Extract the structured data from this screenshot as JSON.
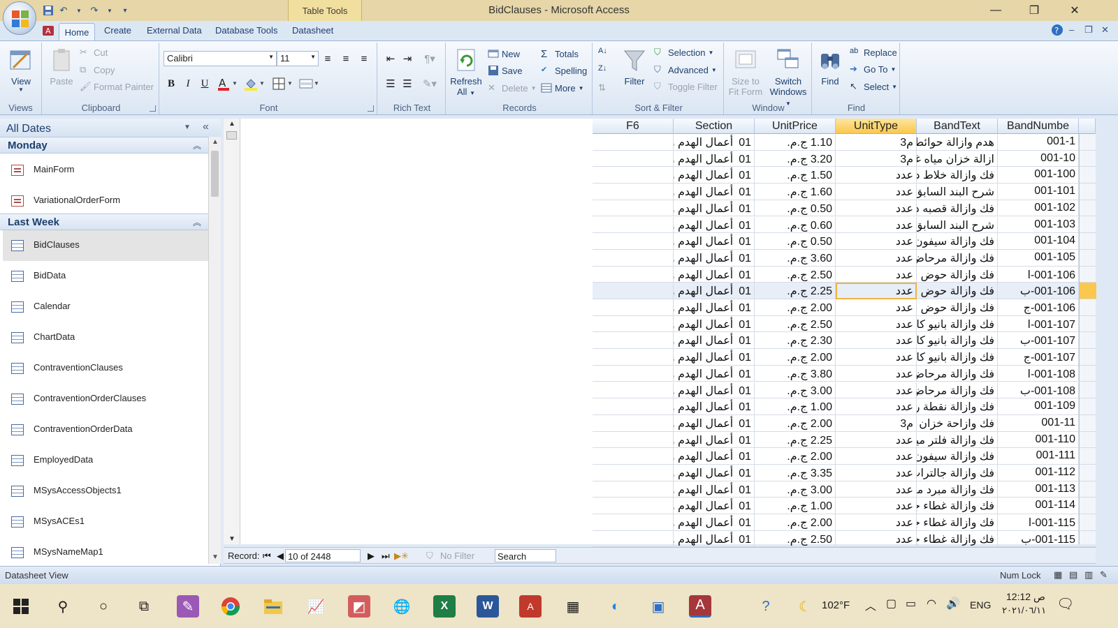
{
  "window": {
    "title": "BidClauses - Microsoft Access",
    "context_tab": "Table Tools"
  },
  "ribbon_tabs": [
    "Home",
    "Create",
    "External Data",
    "Database Tools",
    "Datasheet"
  ],
  "ribbon": {
    "views": {
      "view_label": "View",
      "group": "Views"
    },
    "clipboard": {
      "paste": "Paste",
      "cut": "Cut",
      "copy": "Copy",
      "format_painter": "Format Painter",
      "group": "Clipboard"
    },
    "font": {
      "font_name": "Calibri",
      "font_size": "11",
      "bold": "B",
      "italic": "I",
      "underline": "U",
      "group": "Font"
    },
    "rich_text": {
      "group": "Rich Text"
    },
    "records": {
      "refresh": "Refresh",
      "refresh_all": "All",
      "new": "New",
      "save": "Save",
      "delete": "Delete",
      "totals": "Totals",
      "spelling": "Spelling",
      "more": "More",
      "group": "Records"
    },
    "sort_filter": {
      "filter": "Filter",
      "selection": "Selection",
      "advanced": "Advanced",
      "toggle_filter": "Toggle Filter",
      "group": "Sort & Filter"
    },
    "window": {
      "size_to": "Size to",
      "fit_form": "Fit Form",
      "switch": "Switch",
      "windows": "Windows",
      "group": "Window"
    },
    "find": {
      "find": "Find",
      "replace": "Replace",
      "goto": "Go To",
      "select": "Select",
      "group": "Find"
    }
  },
  "nav_pane": {
    "title": "All Dates",
    "groups": [
      {
        "name": "Monday",
        "items": [
          "MainForm",
          "VariationalOrderForm"
        ]
      },
      {
        "name": "Last Week",
        "items": [
          "BidClauses",
          "BidData",
          "Calendar",
          "ChartData",
          "ContraventionClauses",
          "ContraventionOrderClauses",
          "ContraventionOrderData",
          "EmployedData",
          "MSysAccessObjects1",
          "MSysACEs1",
          "MSysNameMap1"
        ]
      }
    ]
  },
  "datasheet": {
    "columns": [
      "F6",
      "Section",
      "UnitPrice",
      "UnitType",
      "BandText",
      "BandNumbe"
    ],
    "active_column": "UnitType",
    "rows": [
      {
        "f6": "",
        "section": "أعمال الهدم و",
        "sec_no": "01",
        "price": "1.10 ج.م.",
        "unit": "م3",
        "text": "هدم وازالة حوائط د",
        "num": "001-1"
      },
      {
        "f6": "",
        "section": "أعمال الهدم و",
        "sec_no": "01",
        "price": "3.20 ج.م.",
        "unit": "م3",
        "text": "ازالة خزان مياه غير",
        "num": "001-10"
      },
      {
        "f6": "",
        "section": "أعمال الهدم و",
        "sec_no": "01",
        "price": "1.50 ج.م.",
        "unit": "عدد",
        "text": "فك وازالة خلاط دش",
        "num": "001-100"
      },
      {
        "f6": "",
        "section": "أعمال الهدم و",
        "sec_no": "01",
        "price": "1.60 ج.م.",
        "unit": "عدد",
        "text": "شرح البند السابق وا",
        "num": "001-101"
      },
      {
        "f6": "",
        "section": "أعمال الهدم و",
        "sec_no": "01",
        "price": "0.50 ج.م.",
        "unit": "عدد",
        "text": "فك وازالة قصبه دش",
        "num": "001-102"
      },
      {
        "f6": "",
        "section": "أعمال الهدم و",
        "sec_no": "01",
        "price": "0.60 ج.م.",
        "unit": "عدد",
        "text": "شرح البند السابق وا",
        "num": "001-103"
      },
      {
        "f6": "",
        "section": "أعمال الهدم و",
        "sec_no": "01",
        "price": "0.50 ج.م.",
        "unit": "عدد",
        "text": "فك وازالة سيفون م",
        "num": "001-104"
      },
      {
        "f6": "",
        "section": "أعمال الهدم و",
        "sec_no": "01",
        "price": "3.60 ج.م.",
        "unit": "عدد",
        "text": "فك وازالة مرحاض",
        "num": "001-105"
      },
      {
        "f6": "",
        "section": "أعمال الهدم و",
        "sec_no": "01",
        "price": "2.50 ج.م.",
        "unit": "عدد",
        "text": "فك وازالة حوض قد",
        "num": "001-106-ا"
      },
      {
        "f6": "",
        "section": "أعمال الهدم و",
        "sec_no": "01",
        "price": "2.25 ج.م.",
        "unit": "عدد",
        "text": "فك وازالة حوض قد",
        "num": "001-106-ب"
      },
      {
        "f6": "",
        "section": "أعمال الهدم و",
        "sec_no": "01",
        "price": "2.00 ج.م.",
        "unit": "عدد",
        "text": "فك وازالة حوض قد",
        "num": "001-106-ج"
      },
      {
        "f6": "",
        "section": "أعمال الهدم و",
        "sec_no": "01",
        "price": "2.50 ج.م.",
        "unit": "عدد",
        "text": "فك وازالة بانيو كامل",
        "num": "001-107-ا"
      },
      {
        "f6": "",
        "section": "أعمال الهدم و",
        "sec_no": "01",
        "price": "2.30 ج.م.",
        "unit": "عدد",
        "text": "فك وازالة بانيو كامل",
        "num": "001-107-ب"
      },
      {
        "f6": "",
        "section": "أعمال الهدم و",
        "sec_no": "01",
        "price": "2.00 ج.م.",
        "unit": "عدد",
        "text": "فك وازالة بانيو كامل",
        "num": "001-107-ج"
      },
      {
        "f6": "",
        "section": "أعمال الهدم و",
        "sec_no": "01",
        "price": "3.80 ج.م.",
        "unit": "عدد",
        "text": "فك وازالة مرحاض",
        "num": "001-108-ا"
      },
      {
        "f6": "",
        "section": "أعمال الهدم و",
        "sec_no": "01",
        "price": "3.00 ج.م.",
        "unit": "عدد",
        "text": "فك وازالة مرحاض",
        "num": "001-108-ب"
      },
      {
        "f6": "",
        "section": "أعمال الهدم و",
        "sec_no": "01",
        "price": "1.00 ج.م.",
        "unit": "عدد",
        "text": "فك وازالة نقطة ري",
        "num": "001-109"
      },
      {
        "f6": "",
        "section": "أعمال الهدم و",
        "sec_no": "01",
        "price": "2.00 ج.م.",
        "unit": "م3",
        "text": "فك وازاحة خزان مي",
        "num": "001-11"
      },
      {
        "f6": "",
        "section": "أعمال الهدم و",
        "sec_no": "01",
        "price": "2.25 ج.م.",
        "unit": "عدد",
        "text": "فك وازالة فلتر مياه",
        "num": "001-110"
      },
      {
        "f6": "",
        "section": "أعمال الهدم و",
        "sec_no": "01",
        "price": "2.00 ج.م.",
        "unit": "عدد",
        "text": "فك وازالة سيفون أر",
        "num": "001-111"
      },
      {
        "f6": "",
        "section": "أعمال الهدم و",
        "sec_no": "01",
        "price": "3.35 ج.م.",
        "unit": "عدد",
        "text": "فك وازالة جالتراب",
        "num": "001-112"
      },
      {
        "f6": "",
        "section": "أعمال الهدم و",
        "sec_no": "01",
        "price": "3.00 ج.م.",
        "unit": "عدد",
        "text": "فك وازالة مبرد مياه",
        "num": "001-113"
      },
      {
        "f6": "",
        "section": "أعمال الهدم و",
        "sec_no": "01",
        "price": "1.00 ج.م.",
        "unit": "عدد",
        "text": "فك وازالة غطاء جا",
        "num": "001-114"
      },
      {
        "f6": "",
        "section": "أعمال الهدم و",
        "sec_no": "01",
        "price": "2.00 ج.م.",
        "unit": "عدد",
        "text": "فك وازالة غطاء جا",
        "num": "001-115-ا"
      },
      {
        "f6": "",
        "section": "أعمال الهدم و",
        "sec_no": "01",
        "price": "2.50 ج.م.",
        "unit": "عدد",
        "text": "فك وازالة غطاء جا",
        "num": "001-115-ب"
      }
    ],
    "selected_row": 9
  },
  "record_nav": {
    "label": "Record:",
    "position": "10 of 2448",
    "filter": "No Filter",
    "search": "Search"
  },
  "statusbar": {
    "left": "Datasheet View",
    "numlock": "Num Lock"
  },
  "taskbar": {
    "temperature": "102°F",
    "language": "ENG",
    "time": "12:12 ص",
    "date": "٢٠٢١/٠٦/١١"
  },
  "colors": {
    "accent": "#f9c84d",
    "ribbon": "#dbe6f3",
    "titlebar": "#e6d6a8"
  }
}
